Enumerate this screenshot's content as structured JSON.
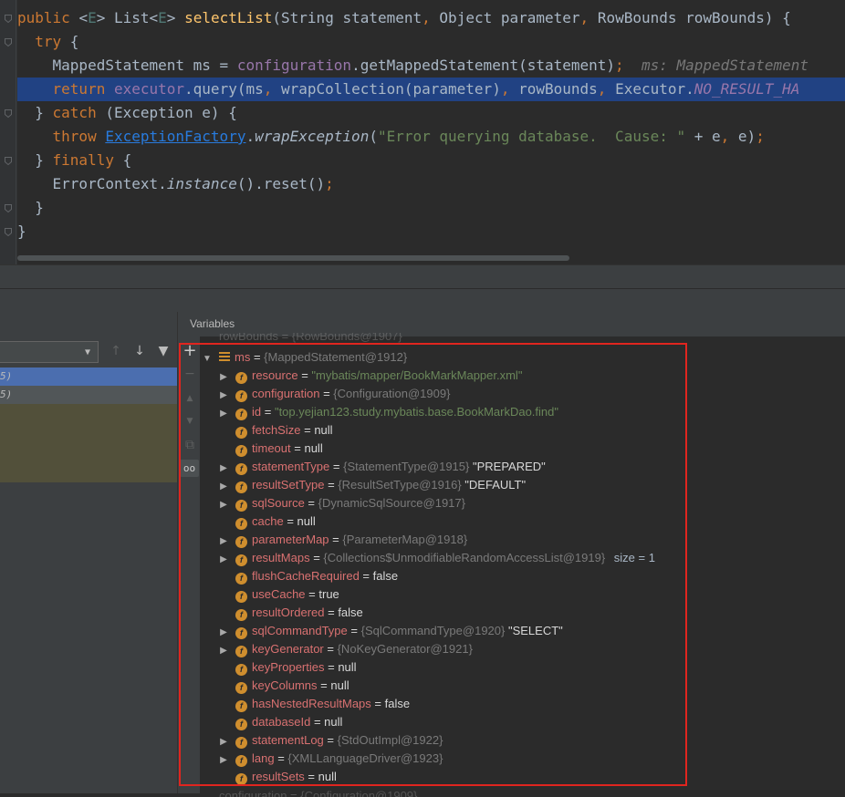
{
  "editor": {
    "lines": [
      {
        "parts": [
          [
            "kw",
            "public "
          ],
          [
            "plain",
            "<"
          ],
          [
            "tp",
            "E"
          ],
          [
            "plain",
            "> List<"
          ],
          [
            "tp",
            "E"
          ],
          [
            "plain",
            "> "
          ],
          [
            "fn",
            "selectList"
          ],
          [
            "plain",
            "(String statement"
          ],
          [
            "kw",
            ", "
          ],
          [
            "plain",
            "Object parameter"
          ],
          [
            "kw",
            ", "
          ],
          [
            "plain",
            "RowBounds rowBounds) {"
          ]
        ]
      },
      {
        "parts": [
          [
            "plain",
            "  "
          ],
          [
            "kw",
            "try "
          ],
          [
            "plain",
            "{"
          ]
        ]
      },
      {
        "parts": [
          [
            "plain",
            "    MappedStatement ms = "
          ],
          [
            "fd",
            "configuration"
          ],
          [
            "plain",
            ".getMappedStatement(statement)"
          ],
          [
            "kw",
            ";"
          ],
          [
            "hint",
            "  ms: MappedStatement"
          ]
        ]
      },
      {
        "highlight": true,
        "parts": [
          [
            "plain",
            "    "
          ],
          [
            "kw",
            "return "
          ],
          [
            "fd",
            "executor"
          ],
          [
            "plain",
            ".query(ms"
          ],
          [
            "kw",
            ", "
          ],
          [
            "plain",
            "wrapCollection(parameter)"
          ],
          [
            "kw",
            ", "
          ],
          [
            "plain",
            "rowBounds"
          ],
          [
            "kw",
            ", "
          ],
          [
            "plain",
            "Executor."
          ],
          [
            "fd it",
            "NO_RESULT_HA"
          ]
        ]
      },
      {
        "parts": [
          [
            "plain",
            "  } "
          ],
          [
            "kw",
            "catch "
          ],
          [
            "plain",
            "(Exception e) {"
          ]
        ]
      },
      {
        "parts": [
          [
            "plain",
            "    "
          ],
          [
            "kw",
            "throw "
          ],
          [
            "cls",
            "ExceptionFactory"
          ],
          [
            "plain",
            "."
          ],
          [
            "it",
            "wrapException"
          ],
          [
            "plain",
            "("
          ],
          [
            "st",
            "\"Error querying database.  Cause: \""
          ],
          [
            "plain",
            " + e"
          ],
          [
            "kw",
            ", "
          ],
          [
            "plain",
            "e)"
          ],
          [
            "kw",
            ";"
          ]
        ]
      },
      {
        "parts": [
          [
            "plain",
            "  } "
          ],
          [
            "kw",
            "finally "
          ],
          [
            "plain",
            "{"
          ]
        ]
      },
      {
        "parts": [
          [
            "plain",
            "    ErrorContext."
          ],
          [
            "it",
            "instance"
          ],
          [
            "plain",
            "().reset()"
          ],
          [
            "kw",
            ";"
          ]
        ]
      },
      {
        "parts": [
          [
            "plain",
            "  }"
          ]
        ]
      },
      {
        "parts": [
          [
            "plain",
            "}"
          ]
        ]
      }
    ]
  },
  "frames": {
    "selected_suffix": "5)",
    "second_suffix": "5)"
  },
  "variables_panel": {
    "title": "Variables",
    "partial_top": "rowBounds = {RowBounds@1907}",
    "partial_bottom": "configuration = {Configuration@1909}",
    "root": {
      "name": "ms",
      "ref": "{MappedStatement@1912}"
    },
    "fields": [
      {
        "name": "resource",
        "sep": " = ",
        "ref": "",
        "str": "\"mybatis/mapper/BookMarkMapper.xml\"",
        "val": "",
        "size": "",
        "expandable": true
      },
      {
        "name": "configuration",
        "sep": " = ",
        "ref": "{Configuration@1909}",
        "str": "",
        "val": "",
        "size": "",
        "expandable": true
      },
      {
        "name": "id",
        "sep": " = ",
        "ref": "",
        "str": "\"top.yejian123.study.mybatis.base.BookMarkDao.find\"",
        "val": "",
        "size": "",
        "expandable": true
      },
      {
        "name": "fetchSize",
        "sep": " = ",
        "ref": "",
        "str": "",
        "val": "null",
        "size": "",
        "expandable": false
      },
      {
        "name": "timeout",
        "sep": " = ",
        "ref": "",
        "str": "",
        "val": "null",
        "size": "",
        "expandable": false
      },
      {
        "name": "statementType",
        "sep": " = ",
        "ref": "{StatementType@1915}",
        "str": "",
        "val": " \"PREPARED\"",
        "size": "",
        "expandable": true
      },
      {
        "name": "resultSetType",
        "sep": " = ",
        "ref": "{ResultSetType@1916}",
        "str": "",
        "val": " \"DEFAULT\"",
        "size": "",
        "expandable": true
      },
      {
        "name": "sqlSource",
        "sep": " = ",
        "ref": "{DynamicSqlSource@1917}",
        "str": "",
        "val": "",
        "size": "",
        "expandable": true
      },
      {
        "name": "cache",
        "sep": " = ",
        "ref": "",
        "str": "",
        "val": "null",
        "size": "",
        "expandable": false
      },
      {
        "name": "parameterMap",
        "sep": " = ",
        "ref": "{ParameterMap@1918}",
        "str": "",
        "val": "",
        "size": "",
        "expandable": true
      },
      {
        "name": "resultMaps",
        "sep": " = ",
        "ref": "{Collections$UnmodifiableRandomAccessList@1919}",
        "str": "",
        "val": "",
        "size": " size = 1",
        "expandable": true
      },
      {
        "name": "flushCacheRequired",
        "sep": " = ",
        "ref": "",
        "str": "",
        "val": "false",
        "size": "",
        "expandable": false
      },
      {
        "name": "useCache",
        "sep": " = ",
        "ref": "",
        "str": "",
        "val": "true",
        "size": "",
        "expandable": false
      },
      {
        "name": "resultOrdered",
        "sep": " = ",
        "ref": "",
        "str": "",
        "val": "false",
        "size": "",
        "expandable": false
      },
      {
        "name": "sqlCommandType",
        "sep": " = ",
        "ref": "{SqlCommandType@1920}",
        "str": "",
        "val": " \"SELECT\"",
        "size": "",
        "expandable": true
      },
      {
        "name": "keyGenerator",
        "sep": " = ",
        "ref": "{NoKeyGenerator@1921}",
        "str": "",
        "val": "",
        "size": "",
        "expandable": true
      },
      {
        "name": "keyProperties",
        "sep": " = ",
        "ref": "",
        "str": "",
        "val": "null",
        "size": "",
        "expandable": false
      },
      {
        "name": "keyColumns",
        "sep": " = ",
        "ref": "",
        "str": "",
        "val": "null",
        "size": "",
        "expandable": false
      },
      {
        "name": "hasNestedResultMaps",
        "sep": " = ",
        "ref": "",
        "str": "",
        "val": "false",
        "size": "",
        "expandable": false
      },
      {
        "name": "databaseId",
        "sep": " = ",
        "ref": "",
        "str": "",
        "val": "null",
        "size": "",
        "expandable": false
      },
      {
        "name": "statementLog",
        "sep": " = ",
        "ref": "{StdOutImpl@1922}",
        "str": "",
        "val": "",
        "size": "",
        "expandable": true
      },
      {
        "name": "lang",
        "sep": " = ",
        "ref": "{XMLLanguageDriver@1923}",
        "str": "",
        "val": "",
        "size": "",
        "expandable": true
      },
      {
        "name": "resultSets",
        "sep": " = ",
        "ref": "",
        "str": "",
        "val": "null",
        "size": "",
        "expandable": false
      }
    ]
  },
  "icons": {
    "field_icon_letter": "f",
    "add_icon": "+",
    "remove_icon": "−",
    "up_icon": "▲",
    "down_icon": "▼",
    "copy_icon": "⧉",
    "glasses_icon": "oo",
    "filter_up_icon": "↑",
    "filter_down_icon": "↓",
    "funnel_icon": "▼"
  },
  "colors": {
    "highlight_line": "#214283",
    "selection_box": "#e0251f",
    "selected_frame": "#4b6eaf"
  }
}
